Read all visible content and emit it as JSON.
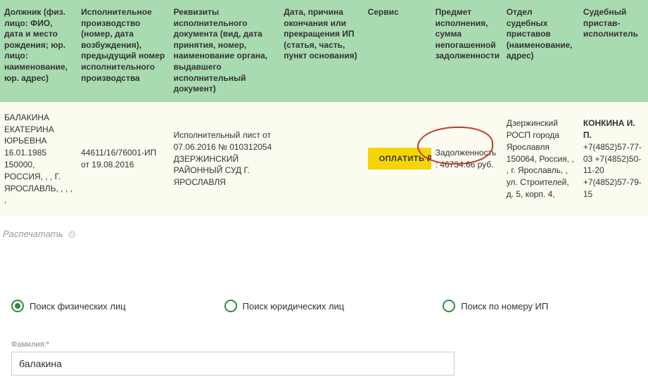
{
  "table": {
    "headers": {
      "debtor": "Должник (физ. лицо: ФИО, дата и место рождения; юр. лицо: наименование, юр. адрес)",
      "proceeding": "Исполнительное производство (номер, дата возбуждения), предыдущий номер исполнительного производства",
      "document": "Реквизиты исполнительного документа (вид, дата принятия, номер, наименование органа, выдавшего исполнительный документ)",
      "termination": "Дата, причина окончания или прекращения ИП (статья, часть, пункт основания)",
      "service": "Сервис",
      "subject": "Предмет исполнения, сумма непогашенной задолженности",
      "department": "Отдел судебных приставов (наименование, адрес)",
      "bailiff": "Судебный пристав-исполнитель"
    },
    "rows": [
      {
        "debtor": "БАЛАКИНА ЕКАТЕРИНА ЮРЬЕВНА 16.01.1985 150000, РОССИЯ, , , Г. ЯРОСЛАВЛЬ, , , , ,",
        "proceeding": "44611/16/76001-ИП от 19.08.2016",
        "document": "Исполнительный лист от 07.06.2016 № 010312054 ДЗЕРЖИНСКИЙ РАЙОННЫЙ СУД Г. ЯРОСЛАВЛЯ",
        "termination": "",
        "pay_label": "ОПЛАТИТЬ",
        "subject": "Задолженность: 46734.66 руб.",
        "department": "Дзержинский РОСП города Ярославля 150064, Россия, , , г. Ярославль, , ул. Строителей, д. 5, корп. 4,",
        "bailiff_name": "КОНКИНА И. П.",
        "bailiff_phones": "+7(4852)57-77-03 +7(4852)50-11-20 +7(4852)57-79-15"
      }
    ]
  },
  "print_label": "Распечатать",
  "search": {
    "radios": {
      "individual": "Поиск физических лиц",
      "legal": "Поиск юридических лиц",
      "byip": "Поиск по номеру ИП"
    },
    "surname_label": "Фамилия:*",
    "surname_value": "балакина"
  }
}
